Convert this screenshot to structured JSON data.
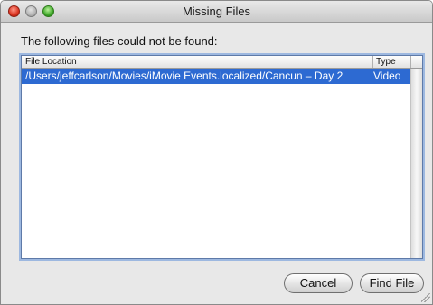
{
  "window": {
    "title": "Missing Files"
  },
  "dialog": {
    "prompt": "The following files could not be found:"
  },
  "table": {
    "columns": [
      "File Location",
      "Type"
    ],
    "rows": [
      {
        "location": "/Users/jeffcarlson/Movies/iMovie Events.localized/Cancun – Day 2",
        "type": "Video",
        "selected": true
      }
    ]
  },
  "buttons": {
    "cancel": "Cancel",
    "find_file": "Find File"
  },
  "colors": {
    "selection": "#2d6ad2",
    "close": "#d9321f",
    "minimize": "#b4b4b4",
    "zoom": "#3fa72a"
  }
}
